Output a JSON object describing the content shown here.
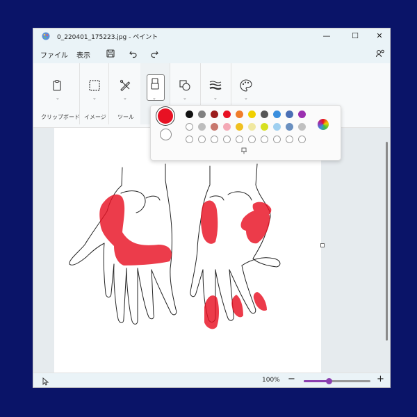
{
  "window": {
    "title": "0_220401_175223.jpg - ペイント",
    "minimize": "—",
    "maximize": "☐",
    "close": "✕"
  },
  "menu": {
    "file": "ファイル",
    "view": "表示"
  },
  "ribbon": {
    "clipboard_label": "クリップボード",
    "image_label": "イメージ",
    "tools_label": "ツール",
    "chevron": "⌄"
  },
  "colors": {
    "primary": "#e81123",
    "secondary": "#ffffff",
    "palette_row1": [
      "#111111",
      "#808080",
      "#9b1c1c",
      "#e81123",
      "#f07d2a",
      "#f0d000",
      "#555555",
      "#3a8fde",
      "#4a6fb5",
      "#9b30b0"
    ],
    "palette_row2": [
      "#ffffff",
      "#bdbdbd",
      "#c8786e",
      "#f4a9b6",
      "#f0c020",
      "#f0e8a0",
      "#d7e020",
      "#9fd0f0",
      "#6a90c0",
      "#c0c0c0"
    ],
    "custom_slots": 10,
    "accent": "#8a3fb0"
  },
  "status": {
    "zoom": "100%",
    "zoom_minus": "−",
    "zoom_plus": "+",
    "zoom_level": 0.38
  }
}
